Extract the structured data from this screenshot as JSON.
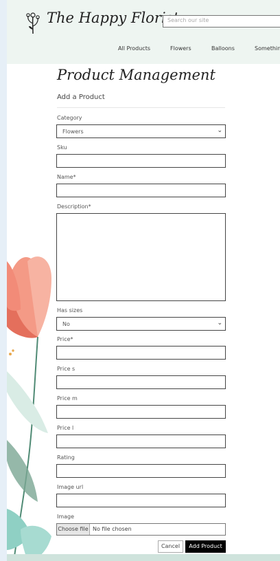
{
  "header": {
    "brand": "The Happy Florist",
    "search_placeholder": "Search our site",
    "nav": [
      "All Products",
      "Flowers",
      "Balloons",
      "Something"
    ]
  },
  "page": {
    "title": "Product Management",
    "subtitle": "Add a Product"
  },
  "form": {
    "category_label": "Category",
    "category_value": "Flowers",
    "sku_label": "Sku",
    "name_label": "Name*",
    "description_label": "Description*",
    "has_sizes_label": "Has sizes",
    "has_sizes_value": "No",
    "price_label": "Price*",
    "price_s_label": "Price s",
    "price_m_label": "Price m",
    "price_l_label": "Price l",
    "rating_label": "Rating",
    "image_url_label": "Image url",
    "image_label": "Image",
    "choose_file": "Choose file",
    "no_file": "No file chosen",
    "cancel": "Cancel",
    "submit": "Add Product"
  },
  "colors": {
    "accent": "#000000",
    "header_bg": "#eef5f1",
    "flower": "#f28b78",
    "leaf": "#5c9b86"
  }
}
